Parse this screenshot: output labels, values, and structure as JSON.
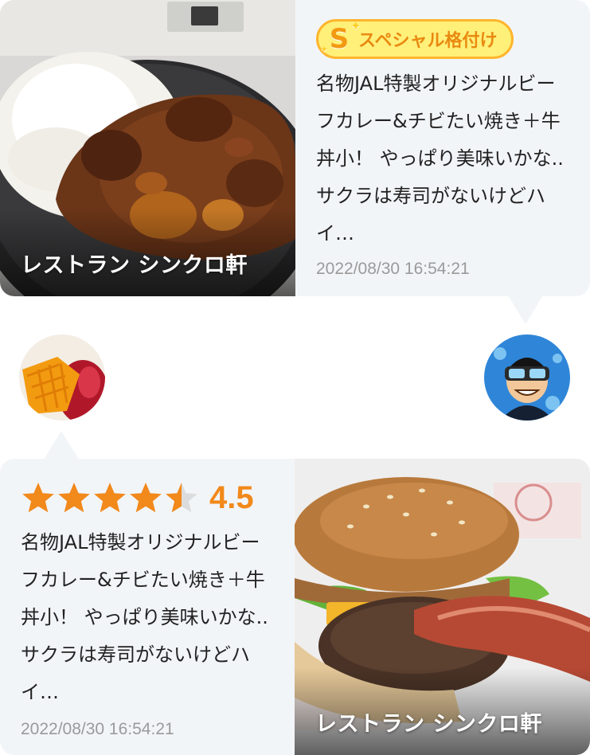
{
  "card1": {
    "photo_caption": "レストラン シンクロ軒",
    "badge": {
      "icon": "S",
      "label": "スペシャル格付け",
      "colors": {
        "fill": "#fff07a",
        "border": "#ffb52c",
        "text": "#e98a10"
      }
    },
    "body": "名物JAL特製オリジナルビーフカレー&チビたい焼き＋牛丼小！ やっぱり美味いかな.. サクラは寿司がないけどハイ…",
    "timestamp": "2022/08/30 16:54:21"
  },
  "card2": {
    "rating": {
      "value": 4.5,
      "display": "4.5",
      "max": 5,
      "color": "#f2891b"
    },
    "body": "名物JAL特製オリジナルビーフカレー&チビたい焼き＋牛丼小！ やっぱり美味いかな.. サクラは寿司がないけどハイ…",
    "timestamp": "2022/08/30 16:54:21",
    "photo_caption": "レストラン シンクロ軒"
  },
  "avatars": {
    "left": {
      "icon": "mango-avatar-icon"
    },
    "right": {
      "icon": "diver-avatar-icon"
    }
  },
  "colors": {
    "panel_bg": "#f2f5f8",
    "star": "#f2891b",
    "star_empty": "#dcdcdc",
    "timestamp": "#9a9a9a"
  }
}
